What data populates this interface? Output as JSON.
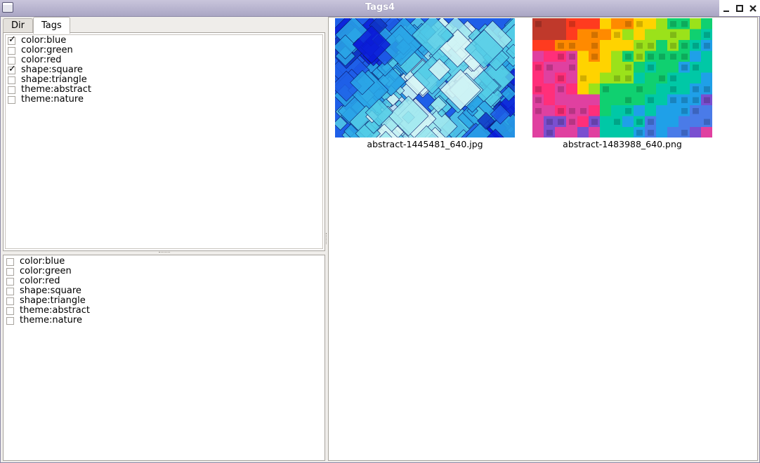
{
  "window": {
    "title": "Tags4",
    "controls": [
      "minimize-icon",
      "maximize-icon",
      "close-icon"
    ]
  },
  "tabs": [
    {
      "label": "Dir",
      "active": false
    },
    {
      "label": "Tags",
      "active": true
    }
  ],
  "tag_panel": {
    "items": [
      {
        "label": "color:blue",
        "checked": true
      },
      {
        "label": "color:green",
        "checked": false
      },
      {
        "label": "color:red",
        "checked": false
      },
      {
        "label": "shape:square",
        "checked": true
      },
      {
        "label": "shape:triangle",
        "checked": false
      },
      {
        "label": "theme:abstract",
        "checked": false
      },
      {
        "label": "theme:nature",
        "checked": false
      }
    ]
  },
  "selected_tags_panel": {
    "items": [
      {
        "label": "color:blue",
        "checked": false
      },
      {
        "label": "color:green",
        "checked": false
      },
      {
        "label": "color:red",
        "checked": false
      },
      {
        "label": "shape:square",
        "checked": false
      },
      {
        "label": "shape:triangle",
        "checked": false
      },
      {
        "label": "theme:abstract",
        "checked": false
      },
      {
        "label": "theme:nature",
        "checked": false
      }
    ]
  },
  "images": [
    {
      "filename": "abstract-1445481_640.jpg",
      "palette": [
        "#0a1cd8",
        "#1e5fe8",
        "#2aa6e6",
        "#53cde6",
        "#9ee8ee",
        "#d7f6f6",
        "#0f36c4"
      ]
    },
    {
      "filename": "abstract-1483988_640.png",
      "palette": [
        "#c0392b",
        "#ff3b1f",
        "#ff8a00",
        "#ffd300",
        "#9be21a",
        "#10d070",
        "#00c8a6",
        "#1fa0e8",
        "#4a7be8",
        "#7a4fd0",
        "#e040a0",
        "#ff2f7a"
      ]
    }
  ],
  "checkmark_glyph": "✓"
}
